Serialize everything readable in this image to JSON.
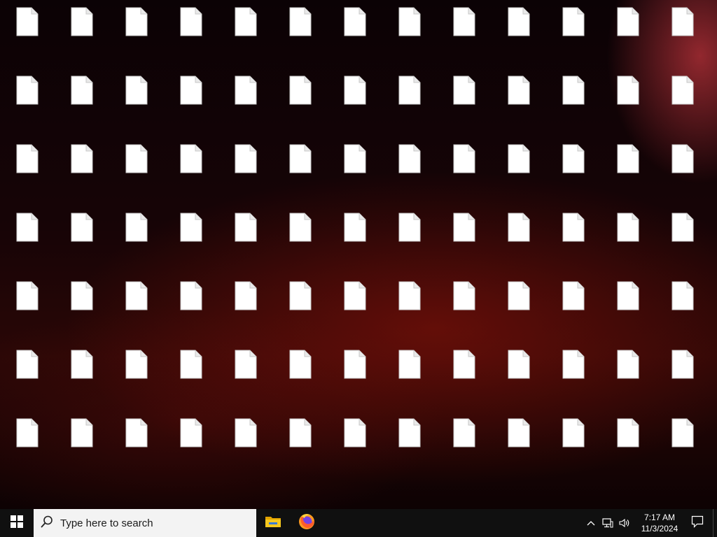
{
  "desktop": {
    "icon_type": "blank-file-icon",
    "rows": 7,
    "columns": 13,
    "icons": [
      {
        "label": ""
      },
      {
        "label": ""
      },
      {
        "label": ""
      },
      {
        "label": ""
      },
      {
        "label": ""
      },
      {
        "label": ""
      },
      {
        "label": ""
      },
      {
        "label": ""
      },
      {
        "label": ""
      },
      {
        "label": ""
      },
      {
        "label": ""
      },
      {
        "label": ""
      },
      {
        "label": ""
      },
      {
        "label": ""
      },
      {
        "label": ""
      },
      {
        "label": ""
      },
      {
        "label": ""
      },
      {
        "label": ""
      },
      {
        "label": ""
      },
      {
        "label": ""
      },
      {
        "label": ""
      },
      {
        "label": ""
      },
      {
        "label": ""
      },
      {
        "label": ""
      },
      {
        "label": ""
      },
      {
        "label": ""
      },
      {
        "label": ""
      },
      {
        "label": ""
      },
      {
        "label": ""
      },
      {
        "label": ""
      },
      {
        "label": ""
      },
      {
        "label": ""
      },
      {
        "label": ""
      },
      {
        "label": ""
      },
      {
        "label": ""
      },
      {
        "label": ""
      },
      {
        "label": ""
      },
      {
        "label": ""
      },
      {
        "label": ""
      },
      {
        "label": ""
      },
      {
        "label": ""
      },
      {
        "label": ""
      },
      {
        "label": ""
      },
      {
        "label": ""
      },
      {
        "label": ""
      },
      {
        "label": ""
      },
      {
        "label": ""
      },
      {
        "label": ""
      },
      {
        "label": ""
      },
      {
        "label": ""
      },
      {
        "label": ""
      },
      {
        "label": ""
      },
      {
        "label": ""
      },
      {
        "label": ""
      },
      {
        "label": ""
      },
      {
        "label": ""
      },
      {
        "label": ""
      },
      {
        "label": ""
      },
      {
        "label": ""
      },
      {
        "label": ""
      },
      {
        "label": ""
      },
      {
        "label": ""
      },
      {
        "label": ""
      },
      {
        "label": ""
      },
      {
        "label": ""
      },
      {
        "label": ""
      },
      {
        "label": ""
      },
      {
        "label": ""
      },
      {
        "label": ""
      },
      {
        "label": ""
      },
      {
        "label": ""
      },
      {
        "label": ""
      },
      {
        "label": ""
      },
      {
        "label": ""
      },
      {
        "label": ""
      },
      {
        "label": ""
      },
      {
        "label": ""
      },
      {
        "label": ""
      },
      {
        "label": ""
      },
      {
        "label": ""
      },
      {
        "label": ""
      },
      {
        "label": ""
      },
      {
        "label": ""
      },
      {
        "label": ""
      },
      {
        "label": ""
      },
      {
        "label": ""
      },
      {
        "label": ""
      },
      {
        "label": ""
      },
      {
        "label": ""
      },
      {
        "label": ""
      },
      {
        "label": ""
      }
    ]
  },
  "taskbar": {
    "start_icon": "windows-logo-icon",
    "search": {
      "placeholder": "Type here to search",
      "icon": "search-icon"
    },
    "pinned_apps": [
      {
        "name": "File Explorer",
        "icon": "folder-icon"
      },
      {
        "name": "Firefox",
        "icon": "firefox-icon"
      }
    ],
    "tray": {
      "icons": [
        "chevron-up-icon",
        "network-icon",
        "volume-icon"
      ],
      "time": "7:17 AM",
      "date": "11/3/2024",
      "notification_icon": "notification-icon"
    },
    "colors": {
      "taskbar_bg": "#101010",
      "search_bg": "#f3f3f3",
      "folder_yellow": "#f0c000",
      "firefox_orange": "#ff7a1a"
    }
  }
}
